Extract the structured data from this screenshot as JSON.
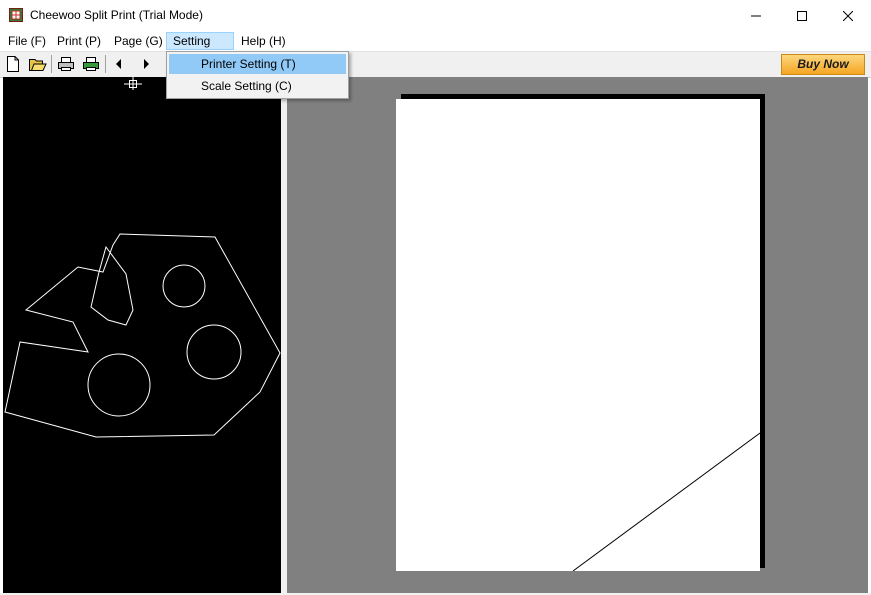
{
  "window": {
    "title": "Cheewoo Split Print (Trial Mode)",
    "controls": [
      "minimize-icon",
      "maximize-icon",
      "close-icon"
    ]
  },
  "menubar": {
    "items": [
      {
        "label": "File (F)"
      },
      {
        "label": "Print (P)"
      },
      {
        "label": "Page (G)"
      },
      {
        "label": "Setting (S)",
        "active": true
      },
      {
        "label": "Help (H)"
      }
    ]
  },
  "toolbar": {
    "buttons": [
      "new-document-icon",
      "open-folder-icon",
      "print-icon",
      "print-setup-icon",
      "previous-icon",
      "next-icon"
    ],
    "buy_now_label": "Buy Now",
    "buy_now_color": "#f5a623"
  },
  "setting_menu": {
    "items": [
      {
        "label": "Printer Setting (T)",
        "highlighted": true
      },
      {
        "label": "Scale Setting (C)"
      }
    ]
  },
  "colors": {
    "drawing_background": "#000000",
    "drawing_lines": "#ffffff",
    "preview_background": "#808080",
    "page": "#ffffff",
    "highlight": "#91c9f7"
  }
}
